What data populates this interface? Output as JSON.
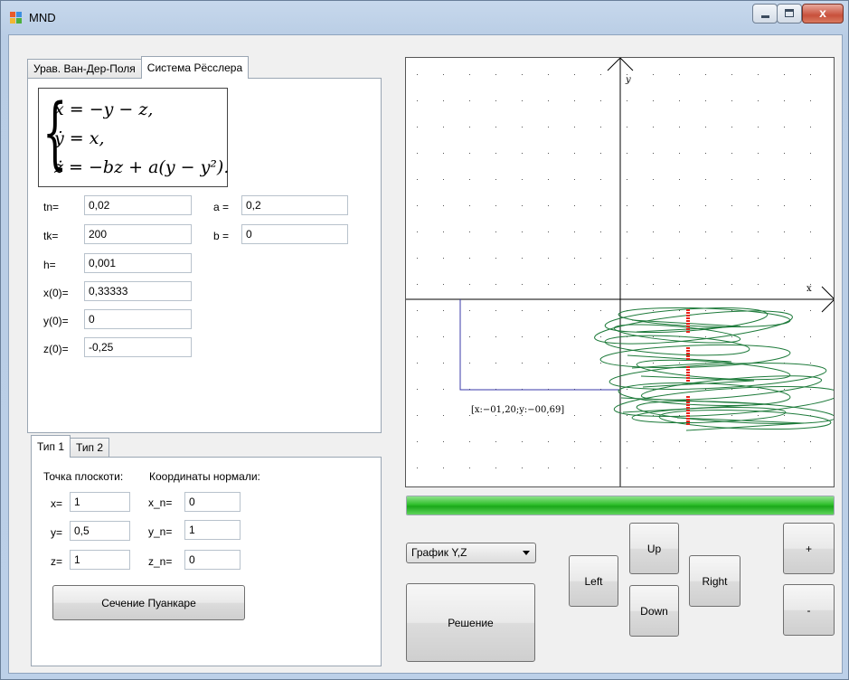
{
  "window": {
    "title": "MND",
    "close_glyph": "x"
  },
  "icons": {
    "app": "app-window-icon",
    "minimize": "minimize-icon",
    "maximize": "maximize-icon",
    "close": "close-icon",
    "dropdown": "chevron-down-icon"
  },
  "system_tabs": [
    {
      "label": "Урав. Ван-Дер-Поля",
      "active": false
    },
    {
      "label": "Система Рёсслера",
      "active": true
    }
  ],
  "equations": [
    "ẋ = −y − z,",
    "ẏ = x,",
    "ż = −bz + a(y − y²)."
  ],
  "params": {
    "tn": {
      "label": "tn=",
      "value": "0,02"
    },
    "tk": {
      "label": "tk=",
      "value": "200"
    },
    "h": {
      "label": "h=",
      "value": "0,001"
    },
    "x0": {
      "label": "x(0)=",
      "value": "0,33333"
    },
    "y0": {
      "label": "y(0)=",
      "value": "0"
    },
    "z0": {
      "label": "z(0)=",
      "value": "-0,25"
    },
    "a": {
      "label": "a =",
      "value": "0,2"
    },
    "b": {
      "label": "b =",
      "value": "0"
    }
  },
  "type_tabs": [
    {
      "label": "Тип 1",
      "active": true
    },
    {
      "label": "Тип 2",
      "active": false
    }
  ],
  "poincare": {
    "point_header": "Точка плоскоти:",
    "normal_header": "Координаты нормали:",
    "x": {
      "label": "x=",
      "value": "1"
    },
    "y": {
      "label": "y=",
      "value": "0,5"
    },
    "z": {
      "label": "z=",
      "value": "1"
    },
    "xn": {
      "label": "x_n=",
      "value": "0"
    },
    "yn": {
      "label": "y_n=",
      "value": "1"
    },
    "zn": {
      "label": "z_n=",
      "value": "0"
    },
    "button": "Сечение Пуанкаре"
  },
  "plot": {
    "y_axis_label": "y",
    "x_axis_label": "x",
    "coord_readout": "[x:−01,20;y:−00,69]",
    "colors": {
      "trajectory": "#1d7a3a",
      "section": "#e8231a",
      "cursor": "#3a3aa8",
      "grid_dot": "#555555"
    }
  },
  "progress": {
    "fraction": 1.0,
    "color": "#22b61f"
  },
  "controls": {
    "graph_select": {
      "value": "График Y,Z"
    },
    "solve": "Решение",
    "up": "Up",
    "down": "Down",
    "left": "Left",
    "right": "Right",
    "zoom_in": "+",
    "zoom_out": "-"
  }
}
